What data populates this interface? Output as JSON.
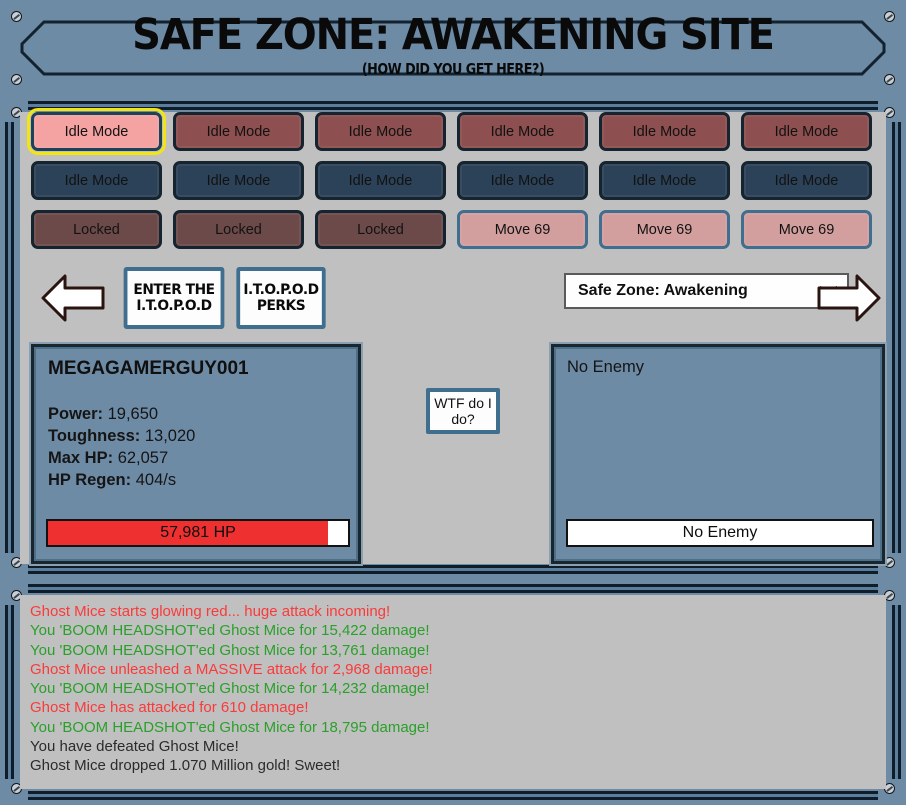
{
  "header": {
    "title": "SAFE ZONE: AWAKENING SITE",
    "subtitle": "(HOW DID YOU GET HERE?)"
  },
  "buttons": {
    "grid": [
      {
        "label": "Idle Mode",
        "style": "selected"
      },
      {
        "label": "Idle Mode",
        "style": "red"
      },
      {
        "label": "Idle Mode",
        "style": "red"
      },
      {
        "label": "Idle Mode",
        "style": "red"
      },
      {
        "label": "Idle Mode",
        "style": "red"
      },
      {
        "label": "Idle Mode",
        "style": "red"
      },
      {
        "label": "Idle Mode",
        "style": "navy"
      },
      {
        "label": "Idle Mode",
        "style": "navy"
      },
      {
        "label": "Idle Mode",
        "style": "navy"
      },
      {
        "label": "Idle Mode",
        "style": "navy"
      },
      {
        "label": "Idle Mode",
        "style": "navy"
      },
      {
        "label": "Idle Mode",
        "style": "navy"
      },
      {
        "label": "Locked",
        "style": "locked"
      },
      {
        "label": "Locked",
        "style": "locked"
      },
      {
        "label": "Locked",
        "style": "locked"
      },
      {
        "label": "Move 69",
        "style": "move"
      },
      {
        "label": "Move 69",
        "style": "move"
      },
      {
        "label": "Move 69",
        "style": "move"
      }
    ]
  },
  "nav": {
    "prev_arrow_icon": "arrow-left-icon",
    "next_arrow_icon": "arrow-right-icon",
    "enter_itopod_label": "ENTER THE\nI.T.O.P.O.D",
    "itopod_perks_label": "I.T.O.P.O.D\nPERKS",
    "zone_select_value": "Safe Zone: Awakening",
    "zone_select_chevron_icon": "chevron-down-icon"
  },
  "player": {
    "name": "MEGAGAMERGUY001",
    "stats": [
      {
        "label": "Power:",
        "value": "19,650"
      },
      {
        "label": "Toughness:",
        "value": "13,020"
      },
      {
        "label": "Max HP:",
        "value": "62,057"
      },
      {
        "label": "HP Regen:",
        "value": "404/s"
      }
    ],
    "hp_text": "57,981 HP",
    "hp_current": 57981,
    "hp_max": 62057,
    "hp_percent": 93.4,
    "hp_fill_color": "#ef3030"
  },
  "enemy": {
    "name": "No Enemy",
    "bar_text": "No Enemy"
  },
  "help": {
    "wtf_label": "WTF do I\ndo?"
  },
  "log": {
    "lines": [
      {
        "text": "Ghost Mice starts glowing red... huge attack incoming!",
        "color": "red"
      },
      {
        "text": "You 'BOOM HEADSHOT'ed Ghost Mice for 15,422 damage!",
        "color": "green"
      },
      {
        "text": "You 'BOOM HEADSHOT'ed Ghost Mice for 13,761 damage!",
        "color": "green"
      },
      {
        "text": "Ghost Mice unleashed a MASSIVE attack for 2,968 damage!",
        "color": "red"
      },
      {
        "text": "You 'BOOM HEADSHOT'ed Ghost Mice for 14,232 damage!",
        "color": "green"
      },
      {
        "text": "Ghost Mice has attacked for 610 damage!",
        "color": "red"
      },
      {
        "text": "You 'BOOM HEADSHOT'ed Ghost Mice for 18,795 damage!",
        "color": "green"
      },
      {
        "text": "You have defeated Ghost Mice!",
        "color": "dark"
      },
      {
        "text": "Ghost Mice dropped 1.070 Million gold! Sweet!",
        "color": "dark"
      }
    ]
  },
  "colors": {
    "frame": "#6e8ba6",
    "content": "#c0c0c0",
    "selected_outline": "#f2e513",
    "hp_red": "#ef3030",
    "log_red": "#fa3a3a",
    "log_green": "#2aa02a"
  }
}
